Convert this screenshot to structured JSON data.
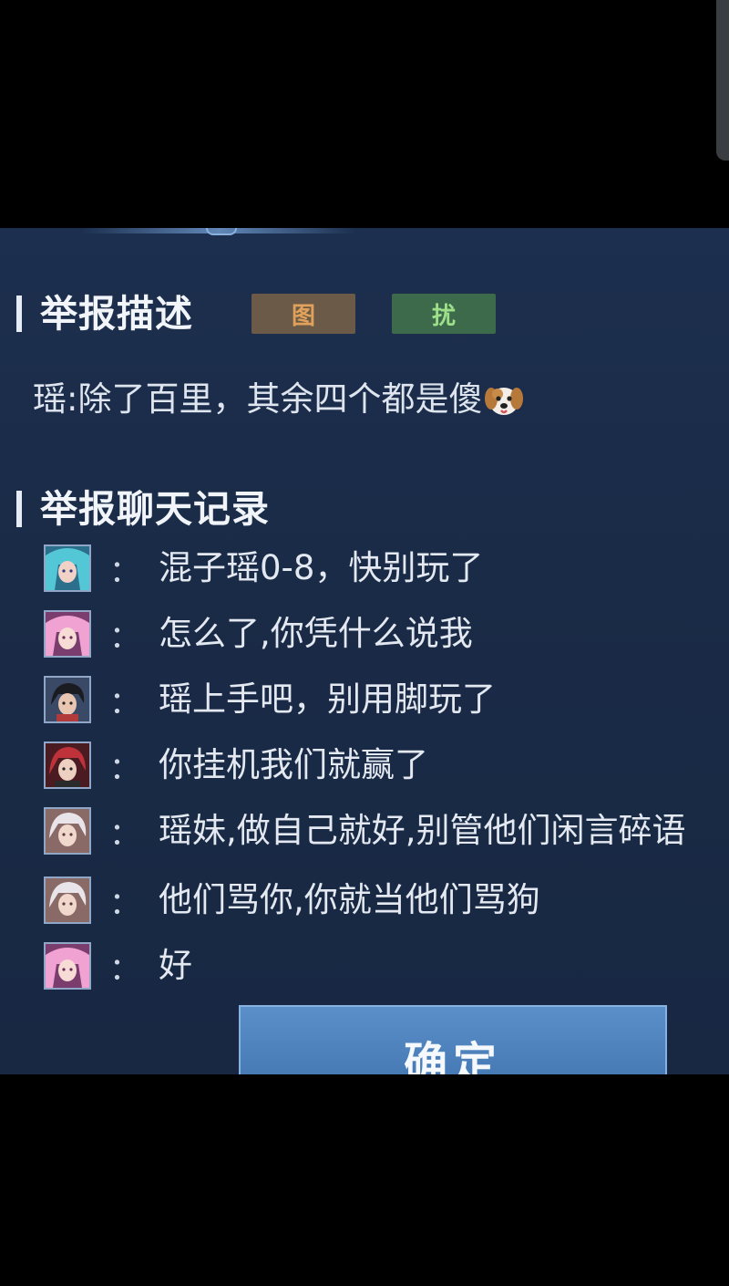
{
  "report_description": {
    "title": "举报描述",
    "badges": [
      {
        "label": "图",
        "color": "#e0a15a"
      },
      {
        "label": "扰",
        "color": "#9ee08a"
      }
    ],
    "text": "瑶:除了百里，其余四个都是傻",
    "emoji_icon": "dog-face-icon"
  },
  "chat_log": {
    "title": "举报聊天记录",
    "messages": [
      {
        "avatar": "hero-avatar-teal-hair",
        "colon": "：",
        "text": "混子瑶0-8，快别玩了"
      },
      {
        "avatar": "hero-avatar-pink-hair",
        "colon": "：",
        "text": "怎么了,你凭什么说我"
      },
      {
        "avatar": "hero-avatar-dark-hair",
        "colon": "：",
        "text": "瑶上手吧，别用脚玩了"
      },
      {
        "avatar": "hero-avatar-red-hair",
        "colon": "：",
        "text": "你挂机我们就赢了"
      },
      {
        "avatar": "hero-avatar-white-hair",
        "colon": "：",
        "text": "瑶妹,做自己就好,别管他们闲言碎语"
      },
      {
        "avatar": "hero-avatar-white-hair",
        "colon": "：",
        "text": "他们骂你,你就当他们骂狗"
      },
      {
        "avatar": "hero-avatar-pink-hair",
        "colon": "：",
        "text": "好"
      }
    ]
  },
  "confirm_button": {
    "label": "确定"
  },
  "colors": {
    "panel_bg": "#1a2b47",
    "button_bg": "#4a7fbb"
  }
}
